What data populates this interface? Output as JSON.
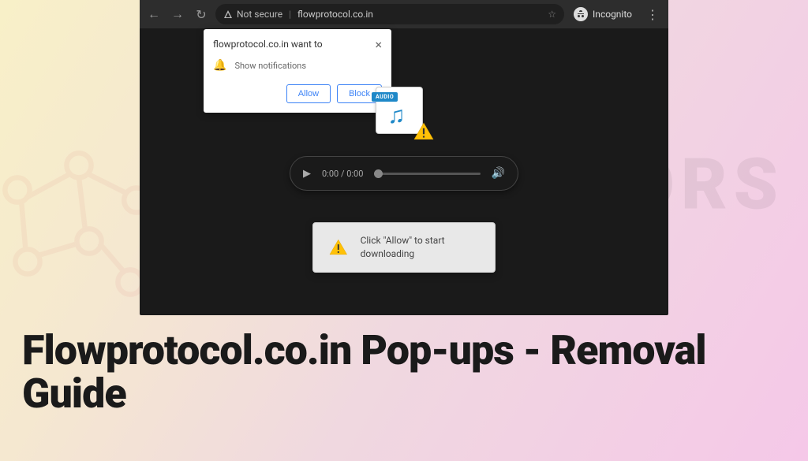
{
  "browser": {
    "security_label": "Not secure",
    "url": "flowprotocol.co.in",
    "incognito_label": "Incognito"
  },
  "permission": {
    "title": "flowprotocol.co.in want to",
    "message": "Show notifications",
    "allow": "Allow",
    "block": "Block"
  },
  "audio": {
    "tag": "AUDIO",
    "time": "0:00 / 0:00"
  },
  "allow_prompt": {
    "text": "Click \"Allow\" to start downloading"
  },
  "headline": "Flowprotocol.co.in Pop-ups - Removal Guide"
}
